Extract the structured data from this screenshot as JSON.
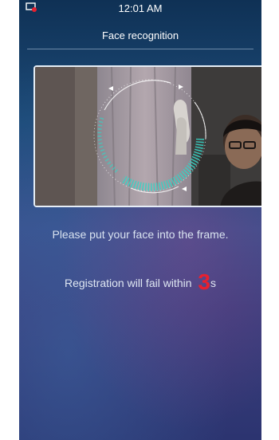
{
  "status_bar": {
    "time": "12:01 AM",
    "notification_icon": "screen-cast-icon"
  },
  "header": {
    "title": "Face recognition"
  },
  "camera": {
    "overlay_icon": "face-scan-ring-icon"
  },
  "instructions": {
    "prompt": "Please put your face into the frame.",
    "countdown_prefix": "Registration will fail within ",
    "countdown_value": "3",
    "countdown_unit": "s"
  },
  "colors": {
    "accent_teal": "#36d3c4",
    "countdown_red": "#e8202f",
    "text_light": "#dfe7f2"
  }
}
